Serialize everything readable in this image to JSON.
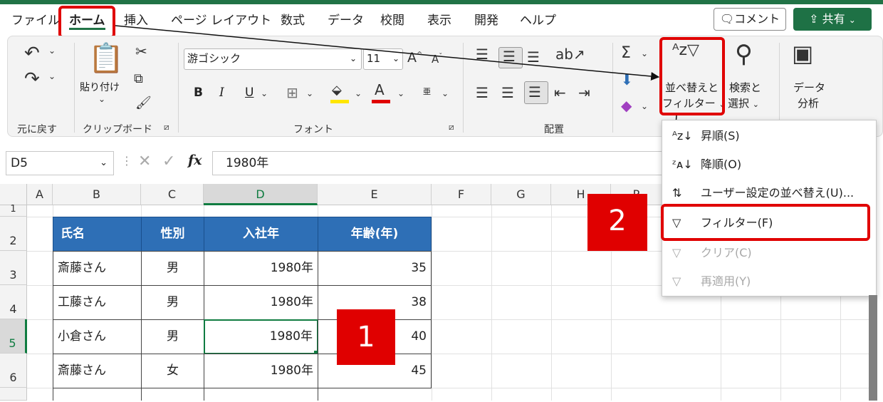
{
  "tabs": [
    "ファイル",
    "ホーム",
    "挿入",
    "ページ レイアウト",
    "数式",
    "データ",
    "校閲",
    "表示",
    "開発",
    "ヘルプ"
  ],
  "header": {
    "comment_label": "コメント",
    "share_label": "共有"
  },
  "ribbon": {
    "undo_group": "元に戻す",
    "clipboard": {
      "paste_label": "貼り付け",
      "group": "クリップボード"
    },
    "font": {
      "name": "游ゴシック",
      "size": "11",
      "bold": "B",
      "italic": "I",
      "underline": "U",
      "phonetic": "亜",
      "group": "フォント"
    },
    "alignment": {
      "group": "配置"
    },
    "sort_filter": {
      "line1": "並べ替えと",
      "line2": "フィルター"
    },
    "find_select": {
      "line1": "検索と",
      "line2": "選択"
    },
    "data_analysis": {
      "line1": "データ",
      "line2": "分析"
    }
  },
  "formula_bar": {
    "name_box": "D5",
    "fx": "fx",
    "value": "1980年"
  },
  "columns": [
    "A",
    "B",
    "C",
    "D",
    "E",
    "F",
    "G",
    "H",
    "P"
  ],
  "rows": [
    "1",
    "2",
    "3",
    "4",
    "5",
    "6"
  ],
  "table": {
    "headers": [
      "氏名",
      "性別",
      "入社年",
      "年齢(年)"
    ],
    "rows": [
      [
        "斎藤さん",
        "男",
        "1980年",
        "35"
      ],
      [
        "工藤さん",
        "男",
        "1980年",
        "38"
      ],
      [
        "小倉さん",
        "男",
        "1980年",
        "40"
      ],
      [
        "斎藤さん",
        "女",
        "1980年",
        "45"
      ]
    ]
  },
  "dropdown": {
    "items": [
      {
        "label": "昇順(S)",
        "enabled": true
      },
      {
        "label": "降順(O)",
        "enabled": true
      },
      {
        "label": "ユーザー設定の並べ替え(U)...",
        "enabled": true
      },
      {
        "label": "フィルター(F)",
        "enabled": true
      },
      {
        "label": "クリア(C)",
        "enabled": false
      },
      {
        "label": "再適用(Y)",
        "enabled": false
      }
    ]
  },
  "callouts": [
    "1",
    "2"
  ],
  "colors": {
    "excel_green": "#217346",
    "highlight_red": "#e00000",
    "table_header_blue": "#2e6fb6"
  }
}
